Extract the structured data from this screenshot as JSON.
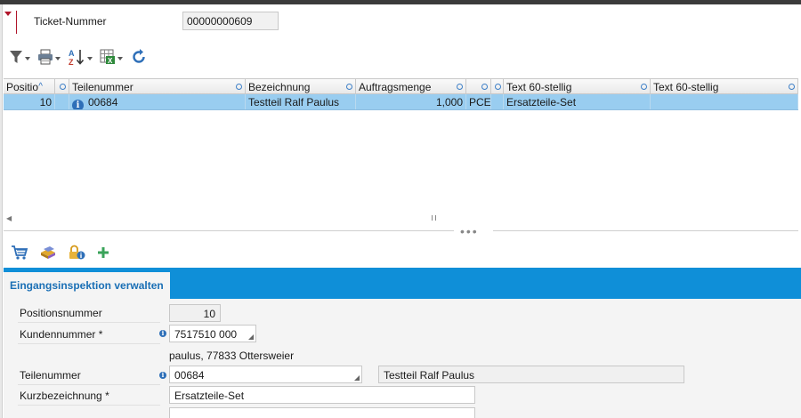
{
  "header": {
    "ticket_label": "Ticket-Nummer",
    "ticket_value": "00000000609"
  },
  "toolbar": {
    "items": [
      "filter-icon",
      "print-icon",
      "sort-az-icon",
      "export-excel-icon",
      "refresh-icon"
    ]
  },
  "grid": {
    "columns": [
      "Positio",
      "",
      "Teilenummer",
      "Bezeichnung",
      "Auftragsmenge",
      "",
      "",
      "Text 60-stellig",
      "Text 60-stellig"
    ],
    "rows": [
      {
        "position": "10",
        "teilenummer": "00684",
        "bezeichnung": "Testteil Ralf Paulus",
        "auftragsmenge": "1,000",
        "einheit": "PCE",
        "flag": "",
        "text1": "Ersatzteile-Set",
        "text2": ""
      }
    ]
  },
  "bottom_toolbar": {
    "items": [
      "cart-icon",
      "parts-box-icon",
      "lock-info-icon",
      "add-icon"
    ]
  },
  "tab": {
    "active_label": "Eingangsinspektion verwalten"
  },
  "form": {
    "positionsnummer_label": "Positionsnummer",
    "positionsnummer_value": "10",
    "kundennummer_label": "Kundennummer *",
    "kundennummer_value": "7517510 000",
    "kunde_address": "paulus, 77833 Ottersweier",
    "teilenummer_label": "Teilenummer",
    "teilenummer_value": "00684",
    "teilenummer_desc": "Testteil Ralf Paulus",
    "kurzbezeichnung_label": "Kurzbezeichnung *",
    "kurzbezeichnung_value": "Ersatzteile-Set",
    "extra_value": ""
  },
  "colors": {
    "accent": "#0f8fd8",
    "selected_row": "#99cdf0",
    "marker": "#b0152a"
  }
}
